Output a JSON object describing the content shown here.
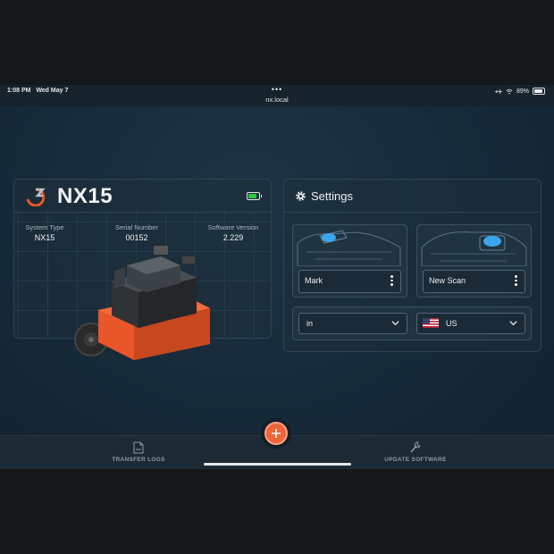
{
  "status_bar": {
    "time": "1:08 PM",
    "date": "Wed May 7",
    "dots": "•••",
    "url": "nx.local",
    "battery": "89%"
  },
  "device": {
    "name": "NX15",
    "battery_icon": "battery-full-icon",
    "info": [
      {
        "label": "System Type",
        "value": "NX15"
      },
      {
        "label": "Serial Number",
        "value": "00152"
      },
      {
        "label": "Software Version",
        "value": "2.229"
      }
    ]
  },
  "settings": {
    "title": "Settings",
    "mode_left": {
      "label": "Mark"
    },
    "mode_right": {
      "label": "New Scan"
    },
    "unit": {
      "label": "in"
    },
    "region": {
      "label": "US"
    }
  },
  "bottom_nav": {
    "left_label": "TRANSFER LOGS",
    "right_label": "UPDATE SOFTWARE"
  },
  "colors": {
    "accent": "#f0643a",
    "battery_green": "#31c43f",
    "device_orange": "#e8562a",
    "highlight_blue": "#3aa6f0"
  }
}
